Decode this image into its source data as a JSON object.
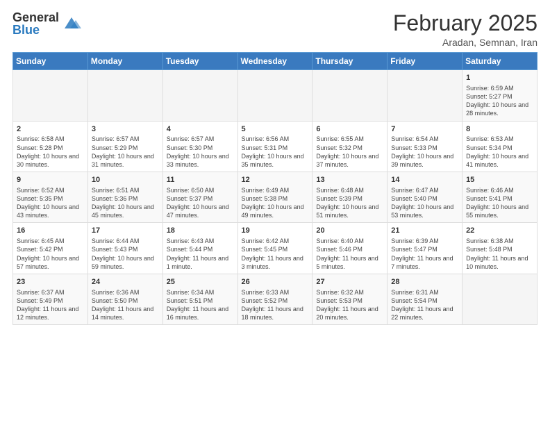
{
  "logo": {
    "general": "General",
    "blue": "Blue"
  },
  "header": {
    "month": "February 2025",
    "location": "Aradan, Semnan, Iran"
  },
  "weekdays": [
    "Sunday",
    "Monday",
    "Tuesday",
    "Wednesday",
    "Thursday",
    "Friday",
    "Saturday"
  ],
  "weeks": [
    [
      {
        "day": "",
        "info": ""
      },
      {
        "day": "",
        "info": ""
      },
      {
        "day": "",
        "info": ""
      },
      {
        "day": "",
        "info": ""
      },
      {
        "day": "",
        "info": ""
      },
      {
        "day": "",
        "info": ""
      },
      {
        "day": "1",
        "info": "Sunrise: 6:59 AM\nSunset: 5:27 PM\nDaylight: 10 hours and 28 minutes."
      }
    ],
    [
      {
        "day": "2",
        "info": "Sunrise: 6:58 AM\nSunset: 5:28 PM\nDaylight: 10 hours and 30 minutes."
      },
      {
        "day": "3",
        "info": "Sunrise: 6:57 AM\nSunset: 5:29 PM\nDaylight: 10 hours and 31 minutes."
      },
      {
        "day": "4",
        "info": "Sunrise: 6:57 AM\nSunset: 5:30 PM\nDaylight: 10 hours and 33 minutes."
      },
      {
        "day": "5",
        "info": "Sunrise: 6:56 AM\nSunset: 5:31 PM\nDaylight: 10 hours and 35 minutes."
      },
      {
        "day": "6",
        "info": "Sunrise: 6:55 AM\nSunset: 5:32 PM\nDaylight: 10 hours and 37 minutes."
      },
      {
        "day": "7",
        "info": "Sunrise: 6:54 AM\nSunset: 5:33 PM\nDaylight: 10 hours and 39 minutes."
      },
      {
        "day": "8",
        "info": "Sunrise: 6:53 AM\nSunset: 5:34 PM\nDaylight: 10 hours and 41 minutes."
      }
    ],
    [
      {
        "day": "9",
        "info": "Sunrise: 6:52 AM\nSunset: 5:35 PM\nDaylight: 10 hours and 43 minutes."
      },
      {
        "day": "10",
        "info": "Sunrise: 6:51 AM\nSunset: 5:36 PM\nDaylight: 10 hours and 45 minutes."
      },
      {
        "day": "11",
        "info": "Sunrise: 6:50 AM\nSunset: 5:37 PM\nDaylight: 10 hours and 47 minutes."
      },
      {
        "day": "12",
        "info": "Sunrise: 6:49 AM\nSunset: 5:38 PM\nDaylight: 10 hours and 49 minutes."
      },
      {
        "day": "13",
        "info": "Sunrise: 6:48 AM\nSunset: 5:39 PM\nDaylight: 10 hours and 51 minutes."
      },
      {
        "day": "14",
        "info": "Sunrise: 6:47 AM\nSunset: 5:40 PM\nDaylight: 10 hours and 53 minutes."
      },
      {
        "day": "15",
        "info": "Sunrise: 6:46 AM\nSunset: 5:41 PM\nDaylight: 10 hours and 55 minutes."
      }
    ],
    [
      {
        "day": "16",
        "info": "Sunrise: 6:45 AM\nSunset: 5:42 PM\nDaylight: 10 hours and 57 minutes."
      },
      {
        "day": "17",
        "info": "Sunrise: 6:44 AM\nSunset: 5:43 PM\nDaylight: 10 hours and 59 minutes."
      },
      {
        "day": "18",
        "info": "Sunrise: 6:43 AM\nSunset: 5:44 PM\nDaylight: 11 hours and 1 minute."
      },
      {
        "day": "19",
        "info": "Sunrise: 6:42 AM\nSunset: 5:45 PM\nDaylight: 11 hours and 3 minutes."
      },
      {
        "day": "20",
        "info": "Sunrise: 6:40 AM\nSunset: 5:46 PM\nDaylight: 11 hours and 5 minutes."
      },
      {
        "day": "21",
        "info": "Sunrise: 6:39 AM\nSunset: 5:47 PM\nDaylight: 11 hours and 7 minutes."
      },
      {
        "day": "22",
        "info": "Sunrise: 6:38 AM\nSunset: 5:48 PM\nDaylight: 11 hours and 10 minutes."
      }
    ],
    [
      {
        "day": "23",
        "info": "Sunrise: 6:37 AM\nSunset: 5:49 PM\nDaylight: 11 hours and 12 minutes."
      },
      {
        "day": "24",
        "info": "Sunrise: 6:36 AM\nSunset: 5:50 PM\nDaylight: 11 hours and 14 minutes."
      },
      {
        "day": "25",
        "info": "Sunrise: 6:34 AM\nSunset: 5:51 PM\nDaylight: 11 hours and 16 minutes."
      },
      {
        "day": "26",
        "info": "Sunrise: 6:33 AM\nSunset: 5:52 PM\nDaylight: 11 hours and 18 minutes."
      },
      {
        "day": "27",
        "info": "Sunrise: 6:32 AM\nSunset: 5:53 PM\nDaylight: 11 hours and 20 minutes."
      },
      {
        "day": "28",
        "info": "Sunrise: 6:31 AM\nSunset: 5:54 PM\nDaylight: 11 hours and 22 minutes."
      },
      {
        "day": "",
        "info": ""
      }
    ]
  ]
}
